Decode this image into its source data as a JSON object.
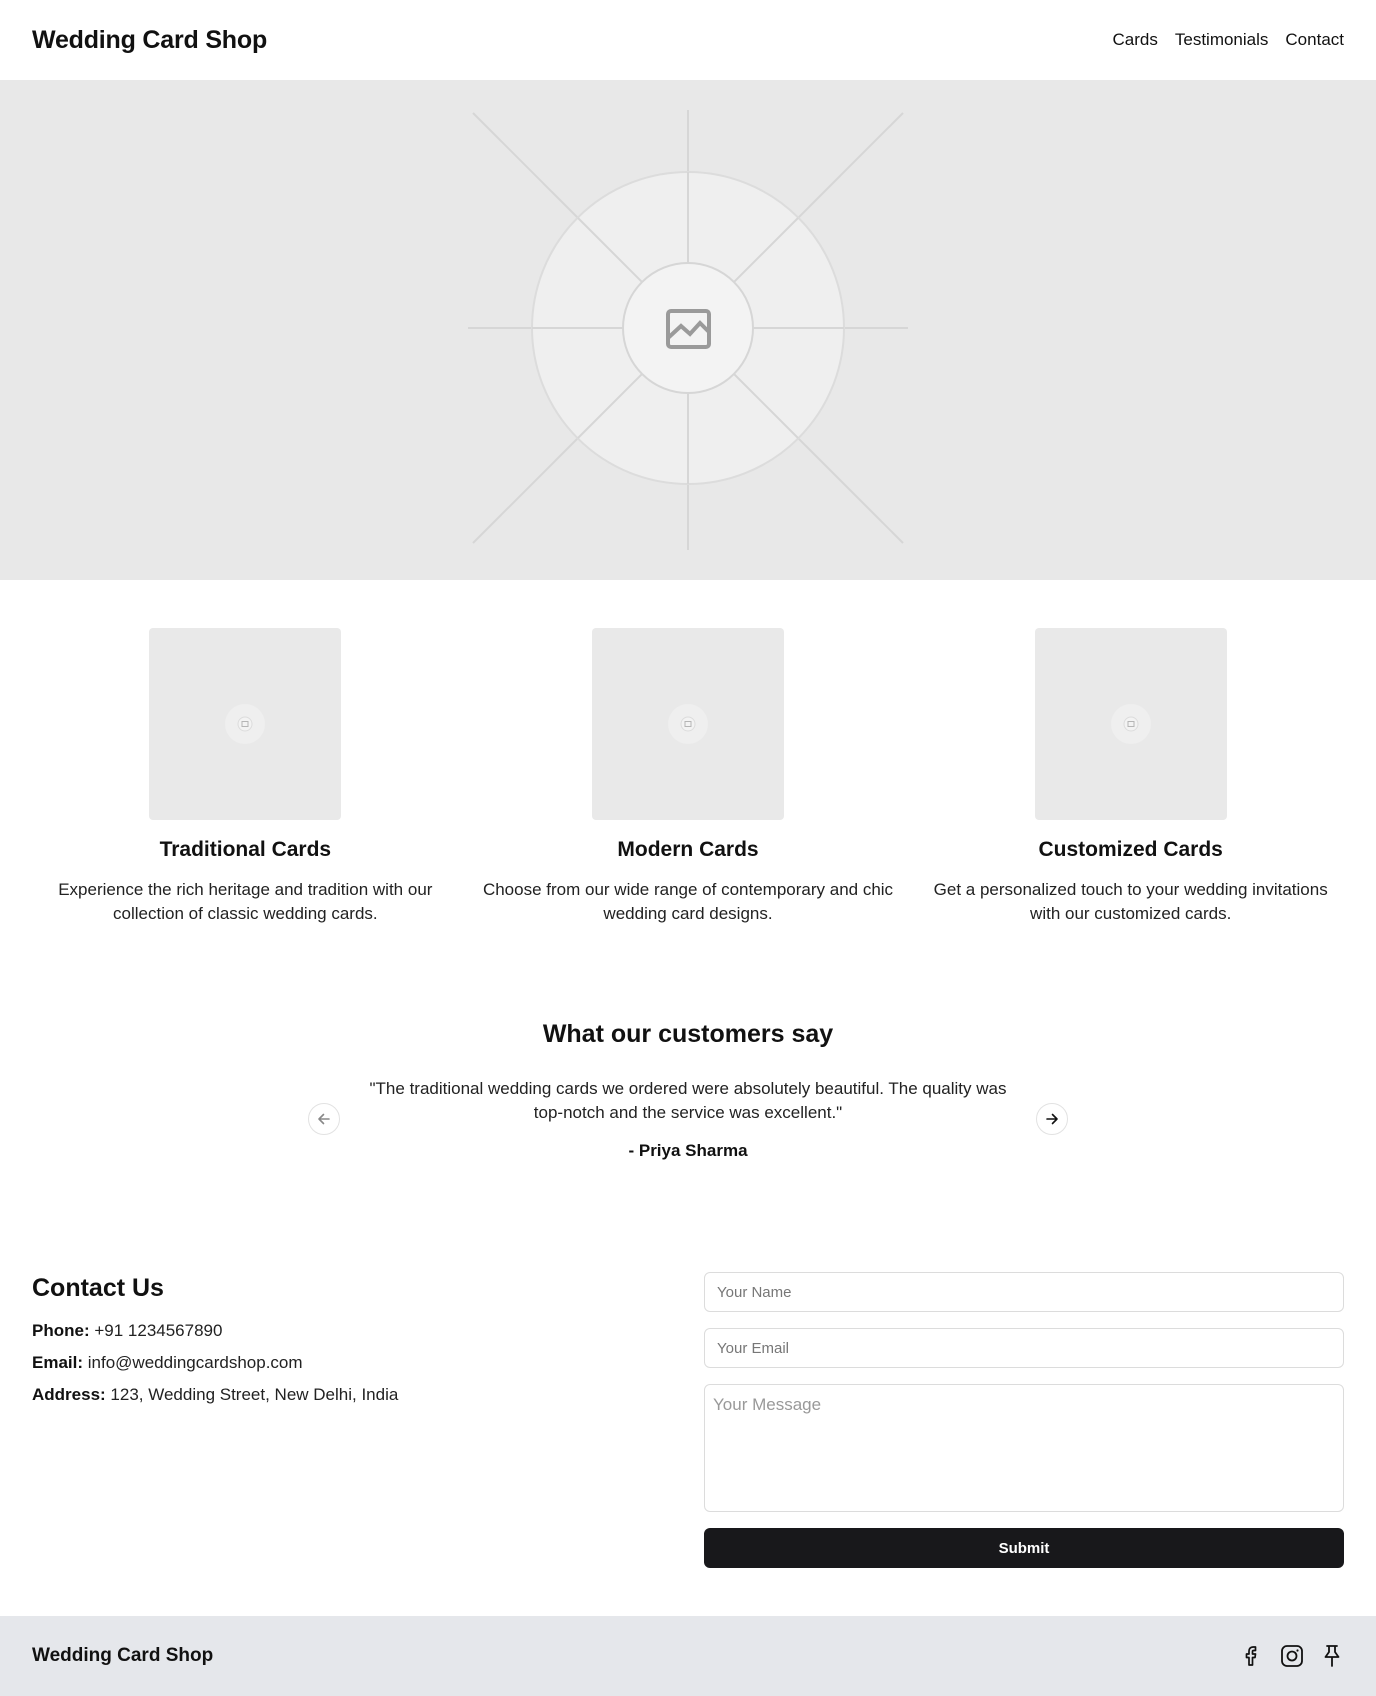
{
  "header": {
    "brand": "Wedding Card Shop",
    "nav": [
      "Cards",
      "Testimonials",
      "Contact"
    ]
  },
  "hero": {
    "image_icon": "image-icon"
  },
  "cards": [
    {
      "title": "Traditional Cards",
      "description": "Experience the rich heritage and tradition with our collection of classic wedding cards."
    },
    {
      "title": "Modern Cards",
      "description": "Choose from our wide range of contemporary and chic wedding card designs."
    },
    {
      "title": "Customized Cards",
      "description": "Get a personalized touch to your wedding invitations with our customized cards."
    }
  ],
  "testimonials": {
    "title": "What our customers say",
    "quote": "\"The traditional wedding cards we ordered were absolutely beautiful. The quality was top-notch and the service was excellent.\"",
    "author": "- Priya Sharma",
    "prev_icon": "arrow-left-icon",
    "next_icon": "arrow-right-icon"
  },
  "contact": {
    "title": "Contact Us",
    "phone_label": "Phone:",
    "phone": "+91 1234567890",
    "email_label": "Email:",
    "email": "info@weddingcardshop.com",
    "address_label": "Address:",
    "address": "123, Wedding Street, New Delhi, India",
    "form": {
      "name_placeholder": "Your Name",
      "email_placeholder": "Your Email",
      "message_placeholder": "Your Message",
      "submit_label": "Submit"
    }
  },
  "footer": {
    "brand": "Wedding Card Shop",
    "socials": [
      "facebook-icon",
      "instagram-icon",
      "pin-icon"
    ]
  },
  "colors": {
    "hero_bg": "#e8e8e8",
    "footer_bg": "#e5e7eb",
    "button_bg": "#18181b"
  }
}
